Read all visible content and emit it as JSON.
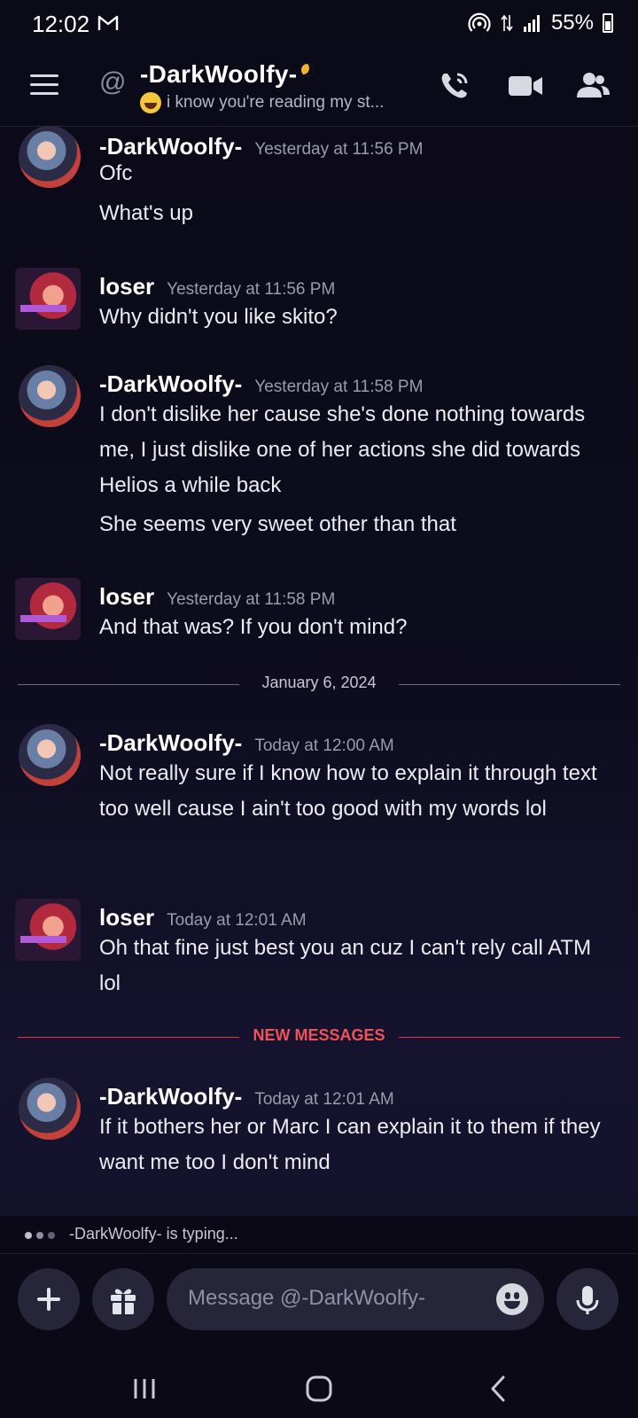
{
  "status_bar": {
    "time": "12:02",
    "battery": "55%"
  },
  "header": {
    "name": "-DarkWoolfy-",
    "status_text": "i know you're reading my st..."
  },
  "messages": [
    {
      "author": "-DarkWoolfy-",
      "time": "Yesterday at 11:56 PM",
      "lines": [
        "Ofc",
        "What's up"
      ]
    },
    {
      "author": "loser",
      "time": "Yesterday at 11:56 PM",
      "lines": [
        "Why didn't you like skito?"
      ]
    },
    {
      "author": "-DarkWoolfy-",
      "time": "Yesterday at 11:58 PM",
      "lines": [
        "I don't dislike her cause she's done nothing towards me, I just dislike one of her actions she did towards Helios a while back",
        "She seems very sweet other than that"
      ]
    },
    {
      "author": "loser",
      "time": "Yesterday at 11:58 PM",
      "lines": [
        "And that was? If you don't mind?"
      ]
    },
    {
      "author": "-DarkWoolfy-",
      "time": "Today at 12:00 AM",
      "lines": [
        "Not really sure if I know how to explain it through text too well cause I ain't too good with my words lol"
      ]
    },
    {
      "author": "loser",
      "time": "Today at 12:01 AM",
      "lines": [
        "Oh that fine just best you an cuz I can't rely call ATM lol"
      ]
    },
    {
      "author": "-DarkWoolfy-",
      "time": "Today at 12:01 AM",
      "lines": [
        "If it bothers her or Marc I can explain it to them if they want me too I don't mind"
      ]
    }
  ],
  "date_divider": "January 6, 2024",
  "new_messages_divider": "NEW MESSAGES",
  "typing": "-DarkWoolfy- is typing...",
  "composer": {
    "placeholder": "Message @-DarkWoolfy-"
  },
  "colors": {
    "accent_new": "#f0525a",
    "away_status": "#f0b232",
    "background": "#0d0c1d"
  },
  "icons": [
    "menu-icon",
    "at-icon",
    "phone-icon",
    "video-icon",
    "members-icon",
    "plus-icon",
    "gift-icon",
    "emoji-icon",
    "mic-icon",
    "recent-apps-icon",
    "home-icon",
    "back-icon"
  ]
}
